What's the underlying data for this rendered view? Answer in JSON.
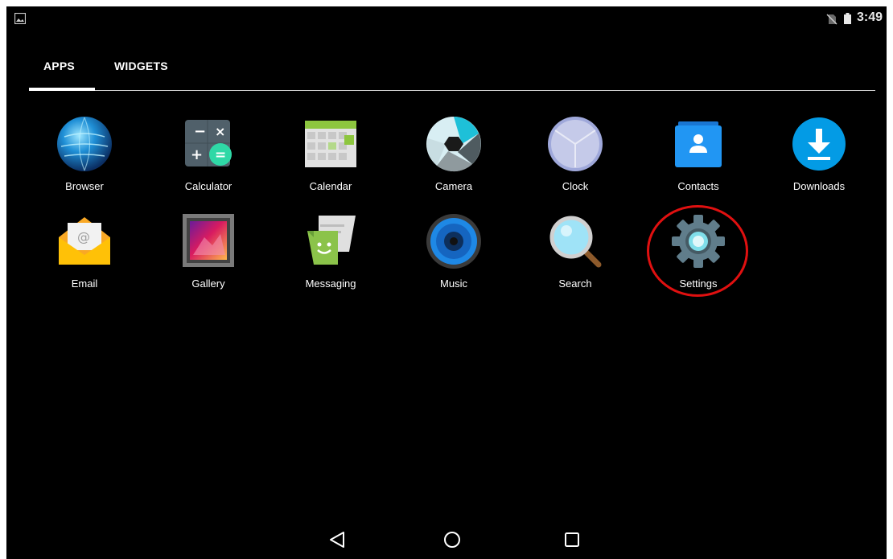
{
  "status_bar": {
    "time": "3:49",
    "icons": [
      "picture-notification-icon",
      "no-sim-icon",
      "battery-icon"
    ]
  },
  "tabs": [
    {
      "label": "APPS",
      "selected": true
    },
    {
      "label": "WIDGETS",
      "selected": false
    }
  ],
  "apps": [
    {
      "label": "Browser",
      "icon": "globe-icon"
    },
    {
      "label": "Calculator",
      "icon": "calculator-icon"
    },
    {
      "label": "Calendar",
      "icon": "calendar-icon"
    },
    {
      "label": "Camera",
      "icon": "camera-aperture-icon"
    },
    {
      "label": "Clock",
      "icon": "clock-icon"
    },
    {
      "label": "Contacts",
      "icon": "contacts-icon"
    },
    {
      "label": "Downloads",
      "icon": "download-icon"
    },
    {
      "label": "Email",
      "icon": "envelope-icon"
    },
    {
      "label": "Gallery",
      "icon": "gallery-icon"
    },
    {
      "label": "Messaging",
      "icon": "messaging-icon"
    },
    {
      "label": "Music",
      "icon": "speaker-icon"
    },
    {
      "label": "Search",
      "icon": "magnifier-icon"
    },
    {
      "label": "Settings",
      "icon": "gear-icon"
    }
  ],
  "highlight": {
    "target": "Settings",
    "color": "#e01010"
  },
  "nav_bar": {
    "icons": [
      "back-icon",
      "home-icon",
      "recents-icon"
    ]
  },
  "colors": {
    "background": "#000000",
    "text": "#ffffff",
    "accent": "#e01010"
  }
}
